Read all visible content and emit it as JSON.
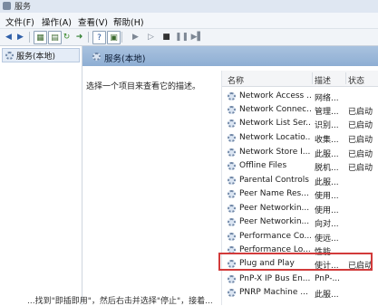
{
  "window": {
    "title": "服务"
  },
  "menu": [
    "文件(F)",
    "操作(A)",
    "查看(V)",
    "帮助(H)"
  ],
  "toolbar": {
    "icons": [
      "back-icon",
      "forward-icon",
      "console-tree-icon",
      "properties-icon",
      "refresh-icon",
      "export-icon",
      "help-icon",
      "view-icon",
      "play-icon",
      "play-outline-icon",
      "stop-icon",
      "pause-icon",
      "resume-icon"
    ]
  },
  "tree": {
    "item_label": "服务(本地)"
  },
  "panel": {
    "header_label": "服务(本地)",
    "description": "选择一个项目来查看它的描述。"
  },
  "list": {
    "columns": [
      "名称",
      "描述",
      "状态"
    ],
    "rows": [
      {
        "name": "Network Access ...",
        "desc": "网络...",
        "status": ""
      },
      {
        "name": "Network Connec...",
        "desc": "管理...",
        "status": "已启动"
      },
      {
        "name": "Network List Ser...",
        "desc": "识别...",
        "status": "已启动"
      },
      {
        "name": "Network Locatio...",
        "desc": "收集...",
        "status": "已启动"
      },
      {
        "name": "Network Store I...",
        "desc": "此服...",
        "status": "已启动"
      },
      {
        "name": "Offline Files",
        "desc": "脱机...",
        "status": "已启动"
      },
      {
        "name": "Parental Controls",
        "desc": "此服...",
        "status": ""
      },
      {
        "name": "Peer Name Res...",
        "desc": "使用...",
        "status": ""
      },
      {
        "name": "Peer Networkin...",
        "desc": "使用...",
        "status": ""
      },
      {
        "name": "Peer Networkin...",
        "desc": "向对...",
        "status": ""
      },
      {
        "name": "Performance Co...",
        "desc": "使远...",
        "status": ""
      },
      {
        "name": "Performance Lo...",
        "desc": "性能...",
        "status": ""
      },
      {
        "name": "Plug and Play",
        "desc": "使计...",
        "status": "已启动"
      },
      {
        "name": "PnP-X IP Bus En...",
        "desc": "PnP-...",
        "status": ""
      },
      {
        "name": "PNRP Machine ...",
        "desc": "此服...",
        "status": ""
      }
    ]
  },
  "caption": "...找到\"即插即用\"，然后右击并选择\"停止\"，接着..."
}
